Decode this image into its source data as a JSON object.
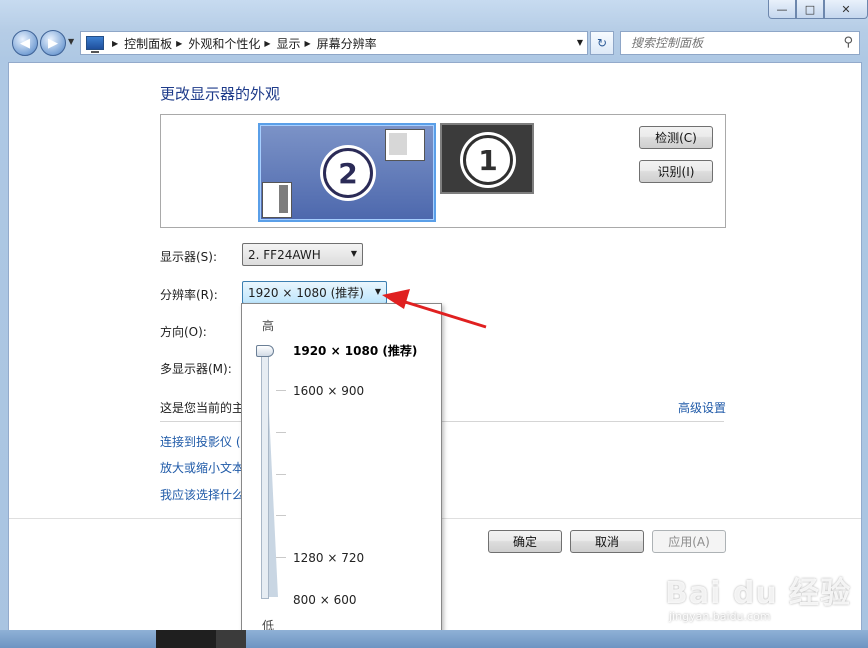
{
  "window": {
    "caption": {
      "minimize": "—",
      "maximize": "□",
      "close": "✕"
    }
  },
  "toolbar": {
    "back_glyph": "◀",
    "forward_glyph": "▶",
    "refresh_glyph": "↻",
    "breadcrumb": [
      "控制面板",
      "外观和个性化",
      "显示",
      "屏幕分辨率"
    ],
    "search_placeholder": "搜索控制面板",
    "search_icon": "magnifier-icon"
  },
  "main": {
    "title": "更改显示器的外观",
    "monitors": [
      {
        "number": "2",
        "selected": true
      },
      {
        "number": "1",
        "selected": false
      }
    ],
    "detect_button": "检测(C)",
    "identify_button": "识别(I)",
    "display_label": "显示器(S):",
    "display_value": "2. FF24AWH",
    "resolution_label": "分辨率(R):",
    "resolution_value": "1920 × 1080 (推荐)",
    "orientation_label": "方向(O):",
    "multiple_displays_label": "多显示器(M):",
    "primary_text": "这是您当前的主",
    "advanced_link": "高级设置",
    "links": [
      "连接到投影仪 (",
      "放大或缩小文本",
      "我应该选择什么"
    ],
    "ok_button": "确定",
    "cancel_button": "取消",
    "apply_button": "应用(A)"
  },
  "resolution_popup": {
    "high_label": "高",
    "low_label": "低",
    "options": [
      {
        "label": "1920 × 1080 (推荐)",
        "selected": true
      },
      {
        "label": "1600 × 900",
        "selected": false
      },
      {
        "label": "1280 × 720",
        "selected": false
      },
      {
        "label": "800 × 600",
        "selected": false
      }
    ]
  },
  "watermark": {
    "logo": "Bai du 经验",
    "url": "jingyan.baidu.com"
  },
  "colors": {
    "title_blue": "#1e3b8a",
    "link_blue": "#1f5aa8",
    "annotation_red": "#e02020"
  }
}
